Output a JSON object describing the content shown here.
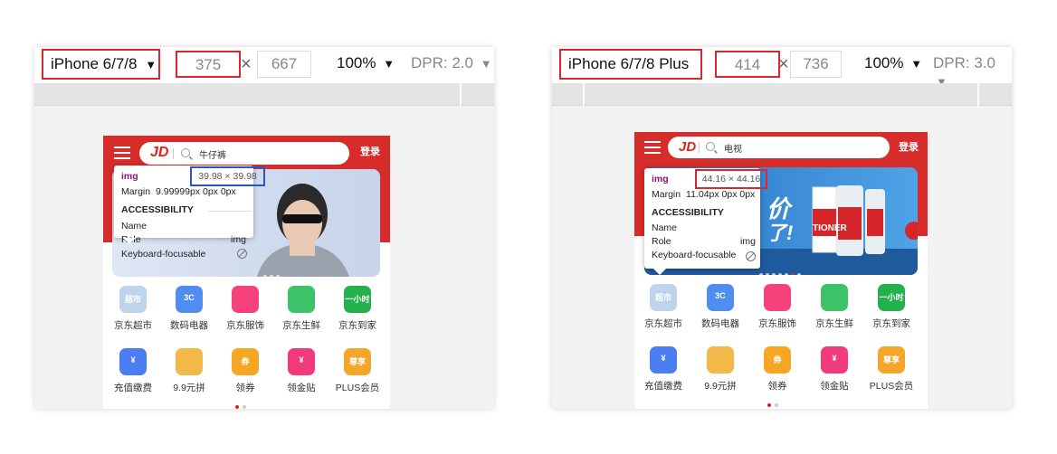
{
  "left": {
    "device": "iPhone 6/7/8",
    "width": "375",
    "height": "667",
    "times": "×",
    "zoom": "100%",
    "dpr": "DPR: 2.0",
    "search_query": "牛仔裤",
    "tooltip": {
      "tag": "img",
      "size": "39.98 × 39.98",
      "margin_label": "Margin",
      "margin_value": "9.99999px 0px 0px",
      "accessibility": "ACCESSIBILITY",
      "name_label": "Name",
      "role_label": "Role",
      "role_value": "img",
      "keyboard_label": "Keyboard-focusable"
    }
  },
  "right": {
    "device": "iPhone 6/7/8 Plus",
    "width": "414",
    "height": "736",
    "times": "×",
    "zoom": "100%",
    "dpr": "DPR: 3.0",
    "search_query": "电视",
    "tooltip": {
      "tag": "img",
      "size": "44.16 × 44.16",
      "margin_label": "Margin",
      "margin_value": "11.04px 0px 0px",
      "accessibility": "ACCESSIBILITY",
      "name_label": "Name",
      "role_label": "Role",
      "role_value": "img",
      "keyboard_label": "Keyboard-focusable"
    }
  },
  "common": {
    "caret": "▼",
    "logo": "JD",
    "login": "登录",
    "banner_text_left": "价",
    "banner_text_left2": "了!",
    "banner_brand": "TIONER"
  },
  "grid": [
    {
      "label": "京东超市",
      "icon": "supermarket-icon",
      "badge": "超市",
      "color": "#a9c6e8"
    },
    {
      "label": "数码电器",
      "icon": "digital-icon",
      "badge": "3C",
      "color": "#4f8ef0"
    },
    {
      "label": "京东服饰",
      "icon": "clothing-icon",
      "badge": "",
      "color": "#f5427a"
    },
    {
      "label": "京东生鲜",
      "icon": "fresh-icon",
      "badge": "",
      "color": "#3cc36a"
    },
    {
      "label": "京东到家",
      "icon": "delivery-icon",
      "badge": "一小时",
      "color": "#22b14c"
    },
    {
      "label": "充值缴费",
      "icon": "recharge-icon",
      "badge": "¥",
      "color": "#4a7ef2"
    },
    {
      "label": "9.9元拼",
      "icon": "group-buy-icon",
      "badge": "",
      "color": "#f2b84a"
    },
    {
      "label": "领券",
      "icon": "coupon-icon",
      "badge": "券",
      "color": "#f5a623"
    },
    {
      "label": "领金贴",
      "icon": "gold-subsidy-icon",
      "badge": "¥",
      "color": "#f03a7a"
    },
    {
      "label": "PLUS会员",
      "icon": "plus-member-icon",
      "badge": "尊享",
      "color": "#f3a62a"
    }
  ],
  "colors": {
    "highlight_red": "#d8282c",
    "highlight_blue": "#2b55c6",
    "jd_red": "#d62c2a"
  }
}
